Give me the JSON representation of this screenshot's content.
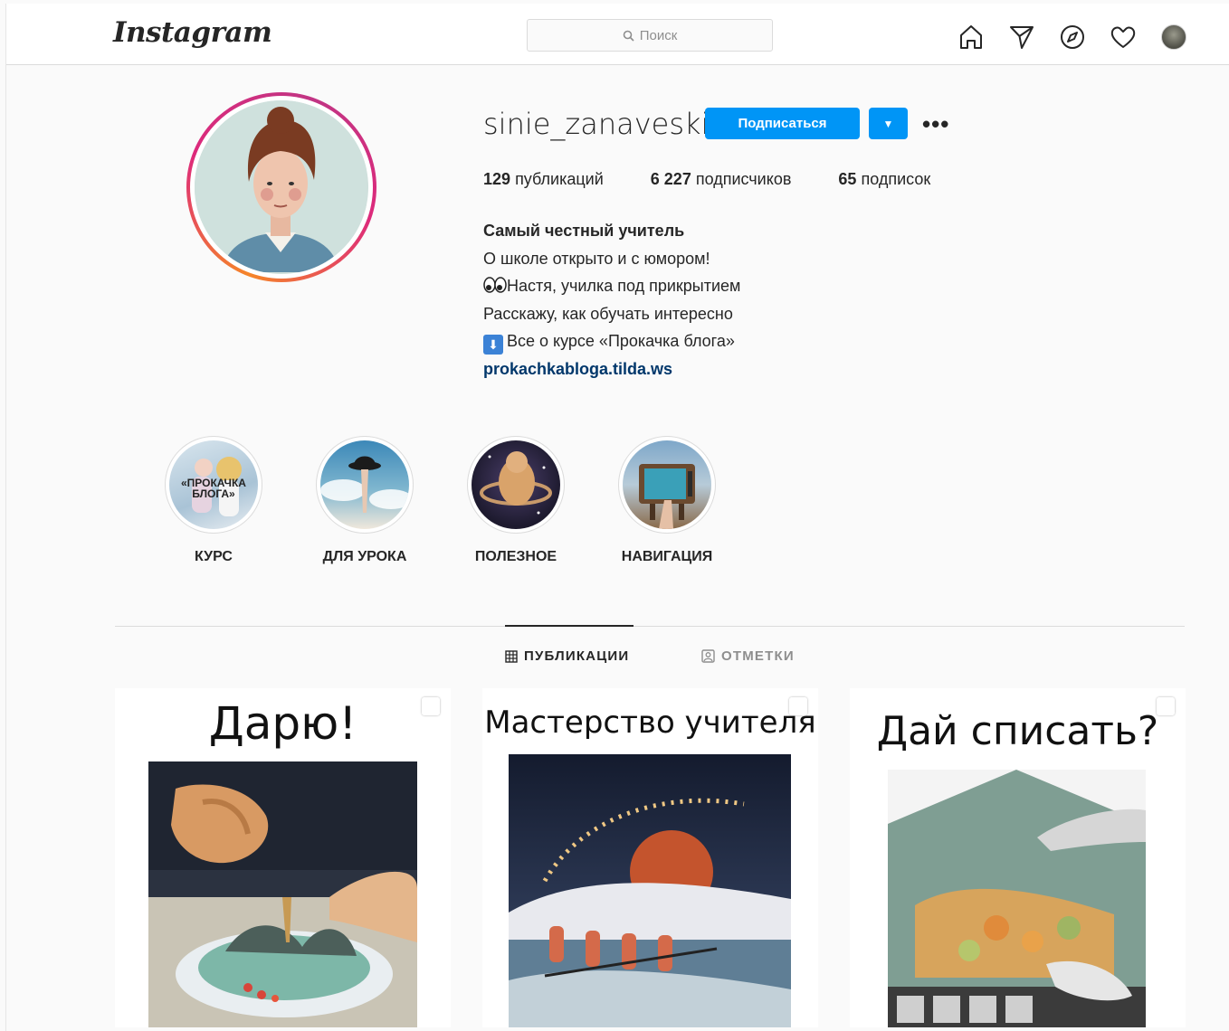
{
  "app": {
    "logo_text": "Instagram"
  },
  "search": {
    "placeholder": "Поиск"
  },
  "nav": {
    "icons": [
      "home-icon",
      "direct-icon",
      "explore-icon",
      "activity-icon",
      "profile-avatar"
    ]
  },
  "profile": {
    "username": "sinie_zanaveski",
    "follow_label": "Подписаться",
    "stats": {
      "posts_count": "129",
      "posts_label": "публикаций",
      "followers_count": "6 227",
      "followers_label": "подписчиков",
      "following_count": "65",
      "following_label": "подписок"
    },
    "bio": {
      "name": "Самый честный учитель",
      "line1": "О школе открыто и с юмором!",
      "line2": "Настя, училка под прикрытием",
      "line3": "Расскажу, как обучать интересно",
      "line4": "Все о курсе «Прокачка блога»",
      "link": "prokachkabloga.tilda.ws"
    }
  },
  "highlights": [
    {
      "label": "КУРС",
      "cover_text": "«ПРОКАЧКА БЛОГА»"
    },
    {
      "label": "ДЛЯ УРОКА"
    },
    {
      "label": "ПОЛЕЗНОЕ"
    },
    {
      "label": "НАВИГАЦИЯ"
    }
  ],
  "tabs": {
    "posts": "ПУБЛИКАЦИИ",
    "tagged": "ОТМЕТКИ"
  },
  "posts": [
    {
      "title": "Дарю!"
    },
    {
      "title": "Мастерство учителя"
    },
    {
      "title": "Дай списать?"
    }
  ],
  "colors": {
    "accent": "#0095f6",
    "link": "#00376b",
    "border": "#dbdbdb"
  }
}
